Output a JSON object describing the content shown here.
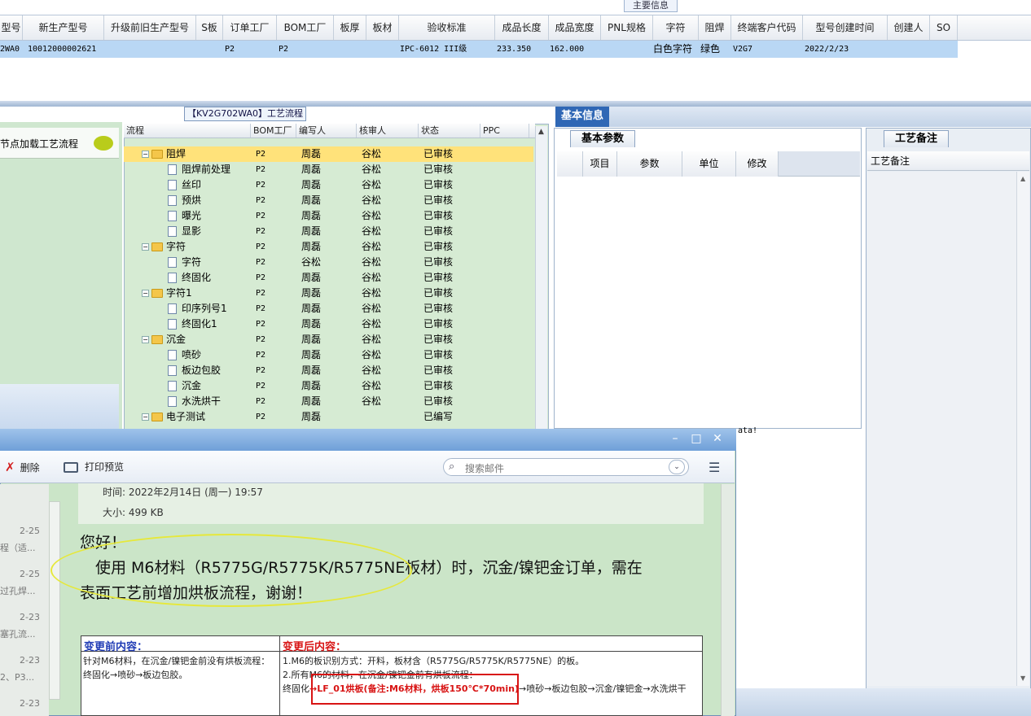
{
  "top": {
    "section_tab": "主要信息",
    "columns": [
      "型号",
      "新生产型号",
      "升级前旧生产型号",
      "S板",
      "订单工厂",
      "BOM工厂",
      "板厚",
      "板材",
      "验收标准",
      "成品长度",
      "成品宽度",
      "PNL规格",
      "字符",
      "阻焊",
      "终端客户代码",
      "型号创建时间",
      "创建人",
      "SO"
    ],
    "row": {
      "model": "2WA0",
      "new_model": "10012000002621",
      "order_factory": "P2",
      "bom_factory": "P2",
      "standard": "IPC-6012 III级",
      "length": "233.350",
      "width": "162.000",
      "char": "白色字符",
      "mask": "绿色",
      "customer": "V2G7",
      "created": "2022/2/23"
    }
  },
  "left_nav": {
    "label": "节点加载工艺流程"
  },
  "tree": {
    "title": "【KV2G702WA0】工艺流程",
    "headers": [
      "流程",
      "BOM工厂",
      "编写人",
      "核审人",
      "状态",
      "PPC"
    ],
    "rows": [
      {
        "name": "阻焊",
        "folder": true,
        "bom": "P2",
        "writer": "周磊",
        "reviewer": "谷松",
        "status": "已审核",
        "selected": true
      },
      {
        "name": "阻焊前处理",
        "folder": false,
        "bom": "P2",
        "writer": "周磊",
        "reviewer": "谷松",
        "status": "已审核"
      },
      {
        "name": "丝印",
        "folder": false,
        "bom": "P2",
        "writer": "周磊",
        "reviewer": "谷松",
        "status": "已审核"
      },
      {
        "name": "预烘",
        "folder": false,
        "bom": "P2",
        "writer": "周磊",
        "reviewer": "谷松",
        "status": "已审核"
      },
      {
        "name": "曝光",
        "folder": false,
        "bom": "P2",
        "writer": "周磊",
        "reviewer": "谷松",
        "status": "已审核"
      },
      {
        "name": "显影",
        "folder": false,
        "bom": "P2",
        "writer": "周磊",
        "reviewer": "谷松",
        "status": "已审核"
      },
      {
        "name": "字符",
        "folder": true,
        "bom": "P2",
        "writer": "周磊",
        "reviewer": "谷松",
        "status": "已审核"
      },
      {
        "name": "字符",
        "folder": false,
        "bom": "P2",
        "writer": "谷松",
        "reviewer": "谷松",
        "status": "已审核"
      },
      {
        "name": "终固化",
        "folder": false,
        "bom": "P2",
        "writer": "周磊",
        "reviewer": "谷松",
        "status": "已审核"
      },
      {
        "name": "字符1",
        "folder": true,
        "bom": "P2",
        "writer": "周磊",
        "reviewer": "谷松",
        "status": "已审核"
      },
      {
        "name": "印序列号1",
        "folder": false,
        "bom": "P2",
        "writer": "周磊",
        "reviewer": "谷松",
        "status": "已审核"
      },
      {
        "name": "终固化1",
        "folder": false,
        "bom": "P2",
        "writer": "周磊",
        "reviewer": "谷松",
        "status": "已审核"
      },
      {
        "name": "沉金",
        "folder": true,
        "bom": "P2",
        "writer": "周磊",
        "reviewer": "谷松",
        "status": "已审核"
      },
      {
        "name": "喷砂",
        "folder": false,
        "bom": "P2",
        "writer": "周磊",
        "reviewer": "谷松",
        "status": "已审核"
      },
      {
        "name": "板边包胶",
        "folder": false,
        "bom": "P2",
        "writer": "周磊",
        "reviewer": "谷松",
        "status": "已审核"
      },
      {
        "name": "沉金",
        "folder": false,
        "bom": "P2",
        "writer": "周磊",
        "reviewer": "谷松",
        "status": "已审核"
      },
      {
        "name": "水洗烘干",
        "folder": false,
        "bom": "P2",
        "writer": "周磊",
        "reviewer": "谷松",
        "status": "已审核"
      },
      {
        "name": "电子测试",
        "folder": true,
        "bom": "P2",
        "writer": "周磊",
        "reviewer": "",
        "status": "已编写"
      }
    ]
  },
  "basic": {
    "tab": "基本信息",
    "params_tab": "基本参数",
    "headers": [
      "项目",
      "参数",
      "单位",
      "修改"
    ],
    "no_data": "ata!"
  },
  "notes": {
    "tab": "工艺备注",
    "header": "工艺备注"
  },
  "mail": {
    "toolbar": {
      "delete": "删除",
      "print_preview": "打印预览",
      "search_placeholder": "搜索邮件"
    },
    "time": "时间: 2022年2月14日 (周一) 19:57",
    "size": "大小: 499 KB",
    "list": [
      {
        "date": "2-25",
        "text": "程（适..."
      },
      {
        "date": "2-25",
        "text": "过孔焊..."
      },
      {
        "date": "2-23",
        "text": "塞孔流..."
      },
      {
        "date": "2-23",
        "text": "2、P3..."
      },
      {
        "date": "2-23",
        "text": ""
      }
    ],
    "greeting": "您好！",
    "line1": "使用 M6材料（R5775G/R5775K/R5775NE板材）时，沉金/镍钯金订单，需在",
    "line2": "表面工艺前增加烘板流程，谢谢！",
    "before_title": "变更前内容：",
    "after_title": "变更后内容：",
    "before_1": "针对M6材料，在沉金/镍钯金前没有烘板流程：",
    "before_2": "终固化→喷砂→板边包胶。",
    "after_1": "1.M6的板识别方式：开料，板材含（R5775G/R5775K/R5775NE）的板。",
    "after_2": "2.所有M6的材料，在沉金/镍钯金前有烘板流程：",
    "after_3a": "终固化",
    "after_3b": "→LF_01烘板(备注:M6材料，烘板150℃*70min)",
    "after_3c": "→喷砂→板边包胶→沉金/镍钯金→水洗烘干"
  },
  "colors": {
    "accent": "#2f67b5",
    "selected_row": "#ffe27a",
    "tree_bg": "#d6ebd3",
    "mail_bg": "#cbe5c8",
    "highlight_red": "#d81414"
  }
}
